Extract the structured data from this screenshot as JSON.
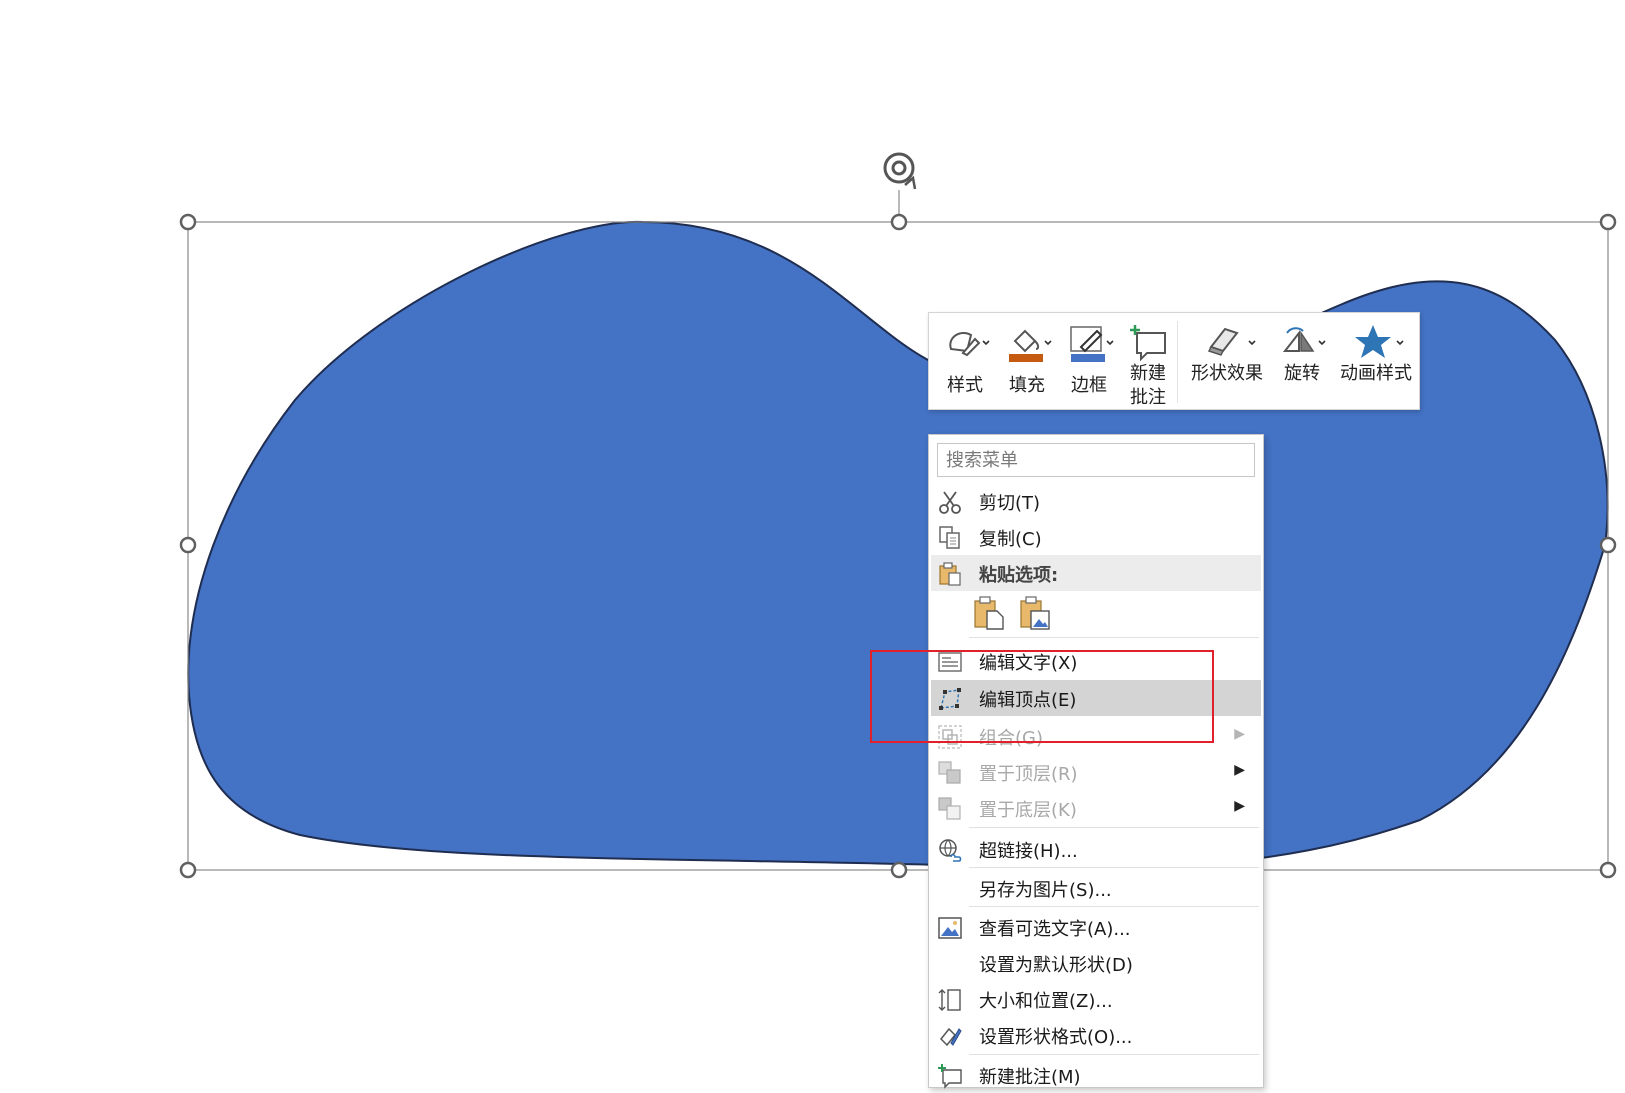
{
  "colors": {
    "shape_fill": "#4472C4",
    "shape_stroke": "#1F2D50",
    "fill_swatch": "#C55A11",
    "border_swatch": "#4472C4",
    "accent_star": "#2E75B6",
    "highlight": "#E0202A"
  },
  "mini_toolbar": {
    "style_label": "样式",
    "fill_label": "填充",
    "border_label": "边框",
    "new_comment_line1": "新建",
    "new_comment_line2": "批注",
    "shape_effects_label": "形状效果",
    "rotate_label": "旋转",
    "animation_label": "动画样式"
  },
  "context_menu": {
    "search_placeholder": "搜索菜单",
    "items": [
      {
        "label": "剪切(T)",
        "icon": "scissors-icon",
        "enabled": true
      },
      {
        "label": "复制(C)",
        "icon": "copy-icon",
        "enabled": true
      },
      {
        "label": "粘贴选项:",
        "icon": "paste-icon",
        "enabled": true
      },
      {
        "label": "编辑文字(X)",
        "icon": "edit-text-icon",
        "enabled": true
      },
      {
        "label": "编辑顶点(E)",
        "icon": "edit-points-icon",
        "enabled": true,
        "hovered": true
      },
      {
        "label": "组合(G)",
        "icon": "group-icon",
        "enabled": false
      },
      {
        "label": "置于顶层(R)",
        "icon": "bring-to-front-icon",
        "enabled": false
      },
      {
        "label": "置于底层(K)",
        "icon": "send-to-back-icon",
        "enabled": false
      },
      {
        "label": "超链接(H)...",
        "icon": "hyperlink-icon",
        "enabled": true
      },
      {
        "label": "另存为图片(S)...",
        "icon": "",
        "enabled": true
      },
      {
        "label": "查看可选文字(A)...",
        "icon": "alt-text-icon",
        "enabled": true
      },
      {
        "label": "设置为默认形状(D)",
        "icon": "",
        "enabled": true
      },
      {
        "label": "大小和位置(Z)...",
        "icon": "size-position-icon",
        "enabled": true
      },
      {
        "label": "设置形状格式(O)...",
        "icon": "format-shape-icon",
        "enabled": true
      },
      {
        "label": "新建批注(M)",
        "icon": "new-comment-icon",
        "enabled": true
      }
    ]
  }
}
